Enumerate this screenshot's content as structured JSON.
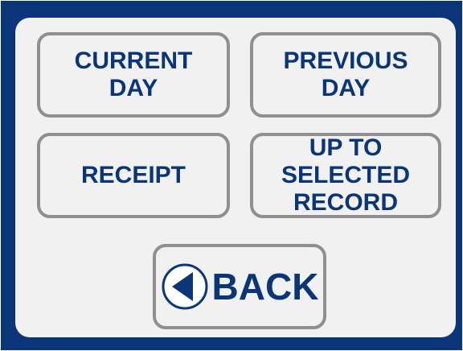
{
  "menu": {
    "current_day": "CURRENT\nDAY",
    "previous_day": "PREVIOUS\nDAY",
    "receipt": "RECEIPT",
    "up_to_selected_record": "UP TO\nSELECTED\nRECORD"
  },
  "back": {
    "label": "BACK",
    "icon": "back-arrow-circle-icon"
  },
  "colors": {
    "frame": "#0a3578",
    "panel": "#f1f1f1",
    "button_border": "#8f8f8f",
    "text": "#0a3578"
  }
}
